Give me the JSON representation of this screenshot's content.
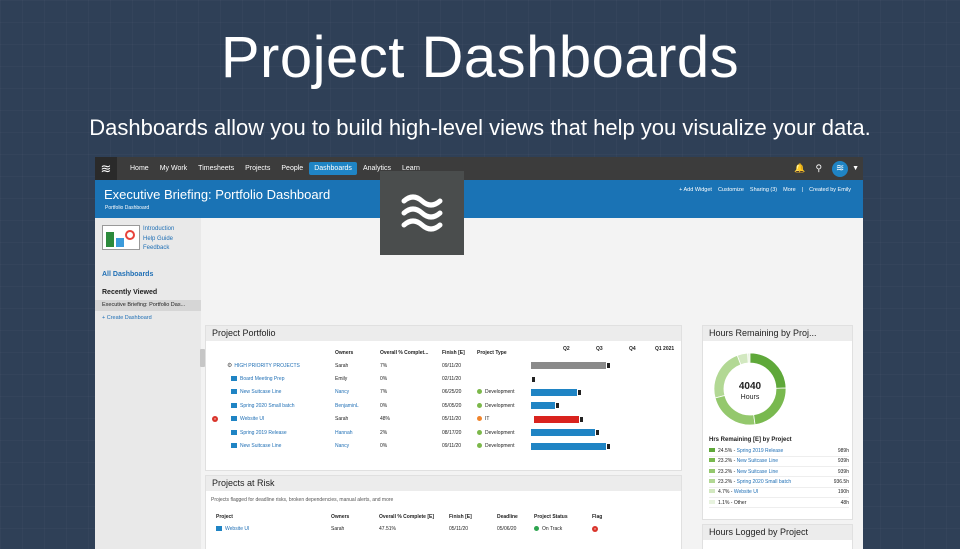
{
  "hero": {
    "title": "Project Dashboards",
    "subtitle": "Dashboards allow you to build high-level views that help you visualize your data."
  },
  "nav": {
    "items": [
      "Home",
      "My Work",
      "Timesheets",
      "Projects",
      "People",
      "Dashboards",
      "Analytics",
      "Learn"
    ],
    "active": "Dashboards"
  },
  "header": {
    "title": "Executive Briefing: Portfolio Dashboard",
    "breadcrumb": "Portfolio Dashboard",
    "actions": [
      "+ Add Widget",
      "Customize",
      "Sharing (3)",
      "More",
      "|",
      "Created by Emily"
    ]
  },
  "sidebar": {
    "links": [
      "Introduction",
      "Help Guide",
      "Feedback"
    ],
    "all_dashboards": "All Dashboards",
    "recently_viewed": "Recently Viewed",
    "recent_item": "Executive Briefing: Portfolio Das...",
    "create": "+ Create Dashboard"
  },
  "portfolio": {
    "title": "Project Portfolio",
    "columns": [
      "",
      "Owners",
      "Overall % Complet...",
      "Finish [E]",
      "Project Type"
    ],
    "quarters": [
      "Q2",
      "Q3",
      "Q4",
      "Q1 2021"
    ],
    "rows": [
      {
        "name": "HIGH PRIORITY PROJECTS",
        "owner": "Sarah",
        "pct": "7%",
        "finish": "09/11/20",
        "type": "",
        "type_color": "",
        "flag": false,
        "group": true,
        "bar_start": 0.0,
        "bar_end": 0.55,
        "bar_color": "#8a8a8a",
        "link_owner": false
      },
      {
        "name": "Board Meeting Prep",
        "owner": "Emily",
        "pct": "0%",
        "finish": "02/11/20",
        "type": "",
        "type_color": "",
        "flag": false,
        "group": false,
        "bar_start": 0.0,
        "bar_end": 0.0,
        "bar_color": "#1f84c4",
        "link_owner": false
      },
      {
        "name": "New Suitcase Line",
        "owner": "Nancy",
        "pct": "7%",
        "finish": "06/25/20",
        "type": "Development",
        "type_color": "#7cb84a",
        "flag": false,
        "group": false,
        "bar_start": 0.0,
        "bar_end": 0.35,
        "bar_color": "#1f84c4",
        "link_owner": true
      },
      {
        "name": "Spring 2020 Small batch",
        "owner": "BenjaminL",
        "pct": "0%",
        "finish": "05/05/20",
        "type": "Development",
        "type_color": "#7cb84a",
        "flag": false,
        "group": false,
        "bar_start": 0.0,
        "bar_end": 0.2,
        "bar_color": "#1f84c4",
        "link_owner": true
      },
      {
        "name": "Website UI",
        "owner": "Sarah",
        "pct": "48%",
        "finish": "05/11/20",
        "type": "IT",
        "type_color": "#f0842c",
        "flag": true,
        "group": false,
        "bar_start": 0.02,
        "bar_end": 0.36,
        "bar_color": "#d9231e",
        "link_owner": false
      },
      {
        "name": "Spring 2019 Release",
        "owner": "Hannah",
        "pct": "2%",
        "finish": "08/17/20",
        "type": "Development",
        "type_color": "#7cb84a",
        "flag": false,
        "group": false,
        "bar_start": 0.0,
        "bar_end": 0.47,
        "bar_color": "#1f84c4",
        "link_owner": true
      },
      {
        "name": "New Suitcase Line",
        "owner": "Nancy",
        "pct": "0%",
        "finish": "09/11/20",
        "type": "Development",
        "type_color": "#7cb84a",
        "flag": false,
        "group": false,
        "bar_start": 0.0,
        "bar_end": 0.55,
        "bar_color": "#1f84c4",
        "link_owner": true
      }
    ]
  },
  "at_risk": {
    "title": "Projects at Risk",
    "subtitle": "Projects flagged for deadline risks, broken dependencies, manual alerts, and more",
    "columns": [
      "Project",
      "Owners",
      "Overall % Complete [E]",
      "Finish [E]",
      "Deadline",
      "Project Status",
      "Flag"
    ],
    "rows": [
      {
        "project": "Website UI",
        "owner": "Sarah",
        "pct": "47.51%",
        "finish": "05/11/20",
        "deadline": "05/06/20",
        "status": "On Track",
        "status_color": "#2ea44f"
      }
    ]
  },
  "hours_remaining": {
    "title": "Hours Remaining by Proj...",
    "center_value": "4040",
    "center_label": "Hours",
    "legend_title": "Hrs Remaining [E] by Project",
    "items": [
      {
        "pct": "24.5%",
        "label": "Spring 2019 Release",
        "value": "989h",
        "fraction": 0.245,
        "color": "#5fa83a",
        "other": false
      },
      {
        "pct": "23.2%",
        "label": "New Suitcase Line",
        "value": "939h",
        "fraction": 0.232,
        "color": "#79b94f",
        "other": false
      },
      {
        "pct": "23.2%",
        "label": "New Suitcase Line",
        "value": "939h",
        "fraction": 0.232,
        "color": "#94c86d",
        "other": false
      },
      {
        "pct": "23.2%",
        "label": "Spring 2020 Small batch",
        "value": "936.5h",
        "fraction": 0.232,
        "color": "#b2d894",
        "other": false
      },
      {
        "pct": "4.7%",
        "label": "Website UI",
        "value": "190h",
        "fraction": 0.047,
        "color": "#d2e8c0",
        "other": false
      },
      {
        "pct": "1.1%",
        "label": "Other",
        "value": "48h",
        "fraction": 0.011,
        "color": "#e8f3df",
        "other": true
      }
    ]
  },
  "hours_logged": {
    "title": "Hours Logged by Project"
  }
}
